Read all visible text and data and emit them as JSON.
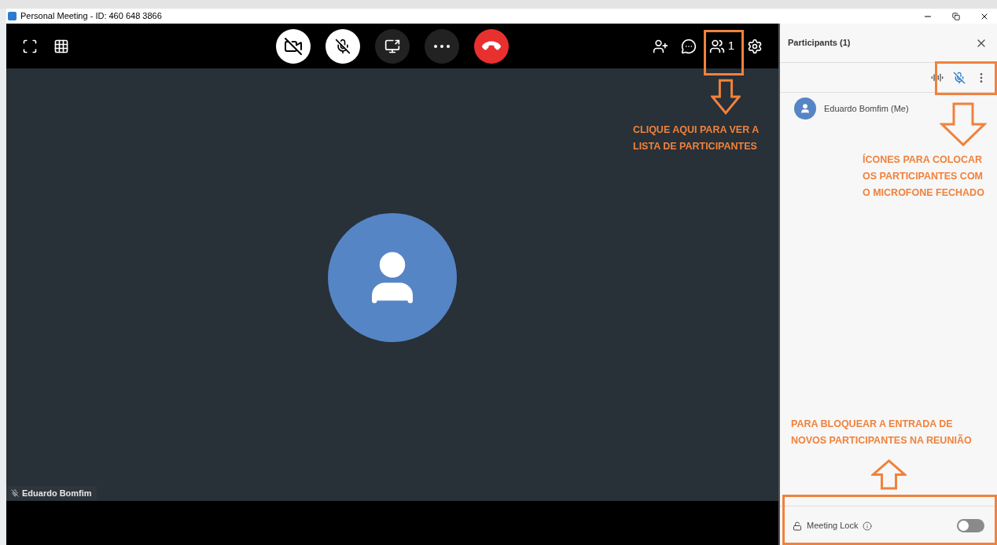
{
  "window": {
    "title": "Personal Meeting - ID: 460 648 3866"
  },
  "toolbar": {
    "controls": [
      {
        "kind": "camera",
        "on": false
      },
      {
        "kind": "mic",
        "on": false
      },
      {
        "kind": "share"
      },
      {
        "kind": "more"
      },
      {
        "kind": "end"
      }
    ],
    "participants_count": "1"
  },
  "video": {
    "name_tag": "Eduardo Bomfim"
  },
  "panel": {
    "title": "Participants (1)",
    "participants": [
      {
        "name": "Eduardo Bomfim (Me)"
      }
    ],
    "meeting_lock": {
      "label": "Meeting Lock",
      "on": false
    }
  },
  "annotations": [
    {
      "lines": [
        "CLIQUE AQUI PARA VER A",
        "LISTA DE PARTICIPANTES"
      ]
    },
    {
      "lines": [
        "ÍCONES PARA COLOCAR",
        "OS PARTICIPANTES COM",
        "O MICROFONE FECHADO"
      ]
    },
    {
      "lines": [
        "PARA BLOQUEAR A ENTRADA DE",
        "NOVOS PARTICIPANTES NA REUNIÃO"
      ]
    }
  ]
}
